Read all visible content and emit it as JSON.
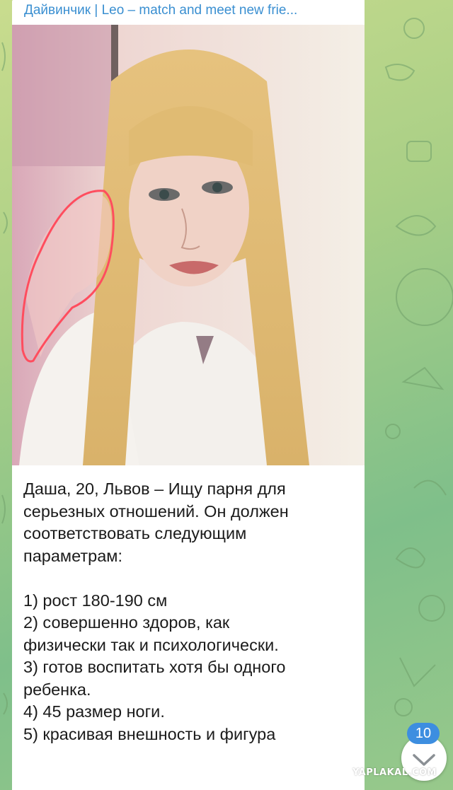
{
  "header": {
    "sender_name": "Дайвинчик | Leo – match and meet new frie..."
  },
  "message": {
    "lines_intro": [
      "Даша, 20, Львов – Ищу парня для",
      "серьезных отношений.  Он должен",
      "соответствовать следующим",
      "параметрам:"
    ],
    "list_items": [
      "1) рост 180-190 см",
      "2) совершенно здоров, как",
      "физически так и психологически.",
      "3) готов воспитать хотя бы одного",
      "ребенка.",
      "4) 45 размер ноги.",
      "5) красивая внешность и фигура"
    ]
  },
  "unread_badge": "10",
  "watermark": "YAPLAKAL.COM",
  "icons": {
    "scroll_down": "chevron-down-icon"
  },
  "colors": {
    "accent": "#3d8ee0",
    "sender": "#3a8fd1",
    "highlight_outline": "#ff4d5e"
  }
}
